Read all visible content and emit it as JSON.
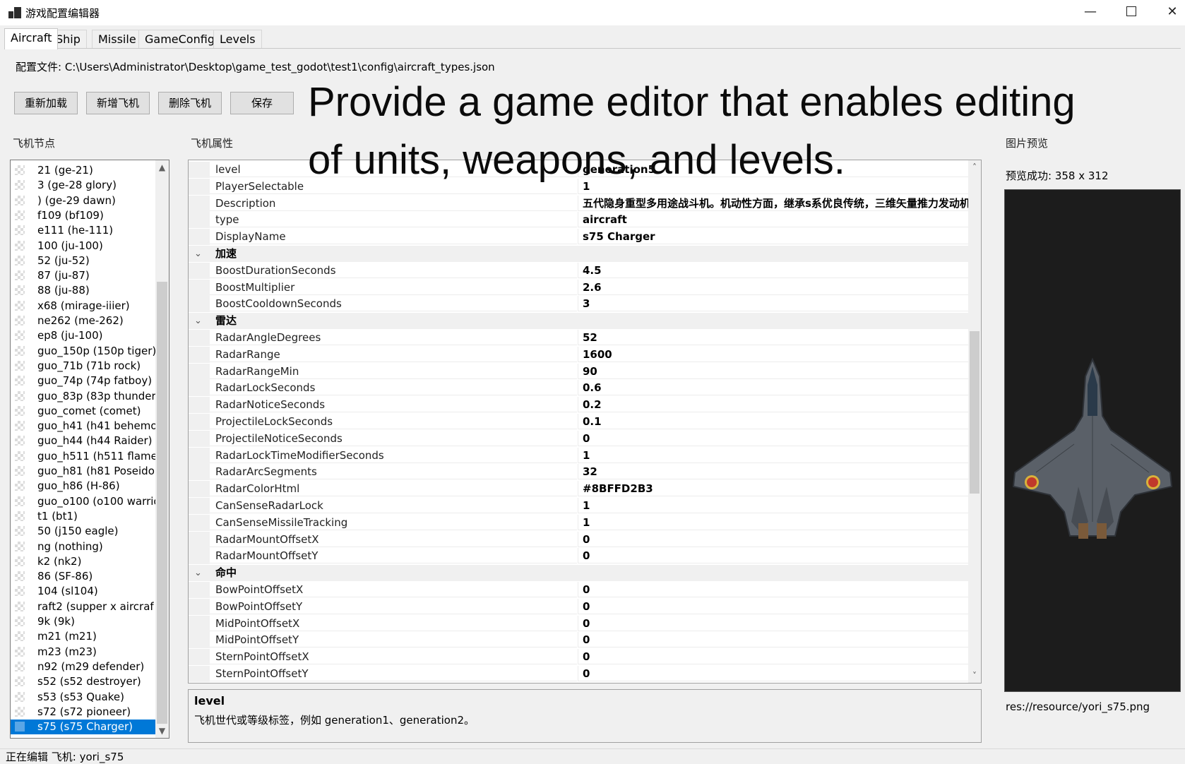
{
  "window": {
    "title": "游戏配置编辑器"
  },
  "tabs": [
    "Aircraft",
    "Ship",
    "Missile",
    "GameConfig",
    "Levels"
  ],
  "config": {
    "path": "配置文件: C:\\Users\\Administrator\\Desktop\\game_test_godot\\test1\\config\\aircraft_types.json"
  },
  "toolbar": {
    "reload": "重新加载",
    "add": "新增飞机",
    "delete": "删除飞机",
    "save": "保存"
  },
  "overlay": {
    "line1": "Provide a game editor that enables editing",
    "line2": "of units, weapons, and levels."
  },
  "labels": {
    "tree": "飞机节点",
    "props": "飞机属性",
    "preview": "图片预览"
  },
  "tree": {
    "items": [
      "21 (ge-21)",
      "3 (ge-28 glory)",
      ") (ge-29 dawn)",
      "f109 (bf109)",
      "e111 (he-111)",
      "100 (ju-100)",
      "52 (ju-52)",
      "87 (ju-87)",
      "88 (ju-88)",
      "x68 (mirage-iiier)",
      "ne262 (me-262)",
      "ep8 (ju-100)",
      "guo_150p (150p tiger)",
      "guo_71b (71b rock)",
      "guo_74p (74p fatboy)",
      "guo_83p (83p thunder",
      "guo_comet (comet)",
      "guo_h41 (h41 behemo",
      "guo_h44 (h44 Raider)",
      "guo_h511 (h511 flame)",
      "guo_h81 (h81 Poseido",
      "guo_h86 (H-86)",
      "guo_o100 (o100 warrio",
      "t1 (bt1)",
      "50 (j150 eagle)",
      "ng (nothing)",
      "k2 (nk2)",
      "86 (SF-86)",
      "104 (sl104)",
      "raft2 (supper x aircraf",
      "9k (9k)",
      "m21 (m21)",
      "m23 (m23)",
      "n92 (m29 defender)",
      "s52 (s52 destroyer)",
      "s53 (s53 Quake)",
      "s72 (s72 pioneer)",
      "s75 (s75 Charger)"
    ],
    "selected_index": 37
  },
  "props": {
    "rows": [
      {
        "name": "level",
        "value": "generation5"
      },
      {
        "name": "PlayerSelectable",
        "value": "1"
      },
      {
        "name": "Description",
        "value": "五代隐身重型多用途战斗机。机动性方面，继承s系优良传统，三维矢量推力发动机"
      },
      {
        "name": "type",
        "value": "aircraft"
      },
      {
        "name": "DisplayName",
        "value": "s75 Charger"
      },
      {
        "category": "加速"
      },
      {
        "name": "BoostDurationSeconds",
        "value": "4.5"
      },
      {
        "name": "BoostMultiplier",
        "value": "2.6"
      },
      {
        "name": "BoostCooldownSeconds",
        "value": "3"
      },
      {
        "category": "雷达"
      },
      {
        "name": "RadarAngleDegrees",
        "value": "52"
      },
      {
        "name": "RadarRange",
        "value": "1600"
      },
      {
        "name": "RadarRangeMin",
        "value": "90"
      },
      {
        "name": "RadarLockSeconds",
        "value": "0.6"
      },
      {
        "name": "RadarNoticeSeconds",
        "value": "0.2"
      },
      {
        "name": "ProjectileLockSeconds",
        "value": "0.1"
      },
      {
        "name": "ProjectileNoticeSeconds",
        "value": "0"
      },
      {
        "name": "RadarLockTimeModifierSeconds",
        "value": "1"
      },
      {
        "name": "RadarArcSegments",
        "value": "32"
      },
      {
        "name": "RadarColorHtml",
        "value": "#8BFFD2B3"
      },
      {
        "name": "CanSenseRadarLock",
        "value": "1"
      },
      {
        "name": "CanSenseMissileTracking",
        "value": "1"
      },
      {
        "name": "RadarMountOffsetX",
        "value": "0"
      },
      {
        "name": "RadarMountOffsetY",
        "value": "0"
      },
      {
        "category": "命中"
      },
      {
        "name": "BowPointOffsetX",
        "value": "0"
      },
      {
        "name": "BowPointOffsetY",
        "value": "0"
      },
      {
        "name": "MidPointOffsetX",
        "value": "0"
      },
      {
        "name": "MidPointOffsetY",
        "value": "0"
      },
      {
        "name": "SternPointOffsetX",
        "value": "0"
      },
      {
        "name": "SternPointOffsetY",
        "value": "0"
      }
    ]
  },
  "help": {
    "title": "level",
    "desc": "飞机世代或等级标签，例如 generation1、generation2。"
  },
  "preview": {
    "status": "预览成功: 358 x 312",
    "resource_path": "res://resource/yori_s75.png"
  },
  "status": {
    "text": "正在编辑 飞机: yori_s75"
  },
  "colors": {
    "selection": "#0078d7",
    "preview_bg": "#1c1c1c",
    "aircraft_body": "#5a6068",
    "star_red": "#c0392b"
  }
}
